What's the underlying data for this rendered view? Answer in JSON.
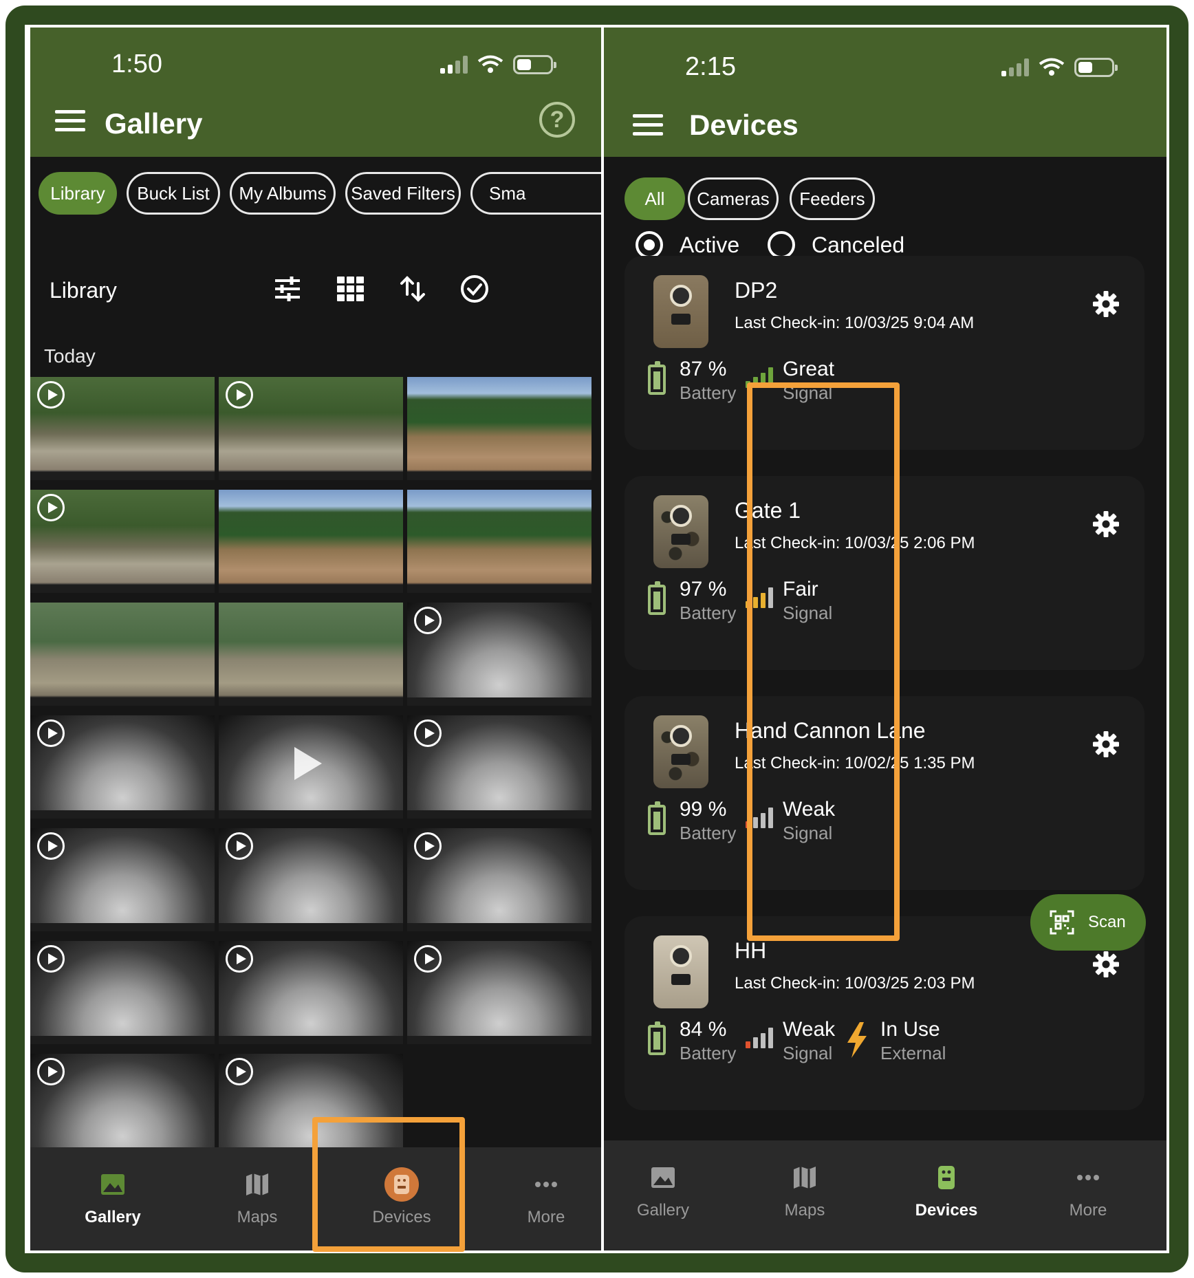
{
  "gallery_screen": {
    "status": {
      "time": "1:50"
    },
    "header": {
      "title": "Gallery",
      "help": "?"
    },
    "chips": [
      "Library",
      "Buck List",
      "My Albums",
      "Saved Filters",
      "Sma"
    ],
    "library_bar": {
      "label": "Library"
    },
    "section": {
      "label": "Today"
    },
    "thumbnails": [
      {
        "kind": "day",
        "video": true
      },
      {
        "kind": "day",
        "video": true
      },
      {
        "kind": "day2",
        "video": false
      },
      {
        "kind": "day",
        "video": true
      },
      {
        "kind": "day2",
        "video": false
      },
      {
        "kind": "day2",
        "video": false
      },
      {
        "kind": "day3",
        "video": false
      },
      {
        "kind": "day3",
        "video": false
      },
      {
        "kind": "night",
        "video": true
      },
      {
        "kind": "night",
        "video": true
      },
      {
        "kind": "night",
        "video": false,
        "big_play": true
      },
      {
        "kind": "night",
        "video": true
      },
      {
        "kind": "night",
        "video": true
      },
      {
        "kind": "night",
        "video": true
      },
      {
        "kind": "night",
        "video": true
      },
      {
        "kind": "night",
        "video": true
      },
      {
        "kind": "night",
        "video": true
      },
      {
        "kind": "night",
        "video": true
      },
      {
        "kind": "night",
        "video": true
      },
      {
        "kind": "night",
        "video": true
      }
    ],
    "nav": [
      {
        "label": "Gallery",
        "selected": true
      },
      {
        "label": "Maps",
        "selected": false
      },
      {
        "label": "Devices",
        "selected": false
      },
      {
        "label": "More",
        "selected": false
      }
    ]
  },
  "devices_screen": {
    "status": {
      "time": "2:15"
    },
    "header": {
      "title": "Devices"
    },
    "chips": [
      "All",
      "Cameras",
      "Feeders"
    ],
    "filters": {
      "active": "Active",
      "canceled": "Canceled"
    },
    "devices": [
      {
        "name": "DP2",
        "checkin": "Last Check-in: 10/03/25 9:04 AM",
        "battery": "87 %",
        "battery_label": "Battery",
        "signal": "Great",
        "signal_label": "Signal",
        "signal_color": "#6ea43c",
        "bars": 4,
        "cam": "brown"
      },
      {
        "name": "Gate 1",
        "checkin": "Last Check-in: 10/03/25 2:06 PM",
        "battery": "97 %",
        "battery_label": "Battery",
        "signal": "Fair",
        "signal_label": "Signal",
        "signal_color": "#e8b030",
        "bars": 3,
        "cam": "camo"
      },
      {
        "name": "Hand Cannon Lane",
        "checkin": "Last Check-in: 10/02/25 1:35 PM",
        "battery": "99 %",
        "battery_label": "Battery",
        "signal": "Weak",
        "signal_label": "Signal",
        "signal_color": "#e0522e",
        "bars": 1,
        "cam": "camo"
      },
      {
        "name": "HH",
        "checkin": "Last Check-in: 10/03/25 2:03 PM",
        "battery": "84 %",
        "battery_label": "Battery",
        "signal": "Weak",
        "signal_label": "Signal",
        "signal_color": "#e0522e",
        "bars": 1,
        "cam": "white",
        "power": "In Use",
        "power_label": "External"
      }
    ],
    "scan": {
      "label": "Scan"
    },
    "nav": [
      {
        "label": "Gallery",
        "selected": false
      },
      {
        "label": "Maps",
        "selected": false
      },
      {
        "label": "Devices",
        "selected": true
      },
      {
        "label": "More",
        "selected": false
      }
    ]
  },
  "colors": {
    "header_green": "#46612a",
    "accent_green": "#5d8a34",
    "highlight_orange": "#f4a13a",
    "frame_green": "#2f4a1f"
  }
}
